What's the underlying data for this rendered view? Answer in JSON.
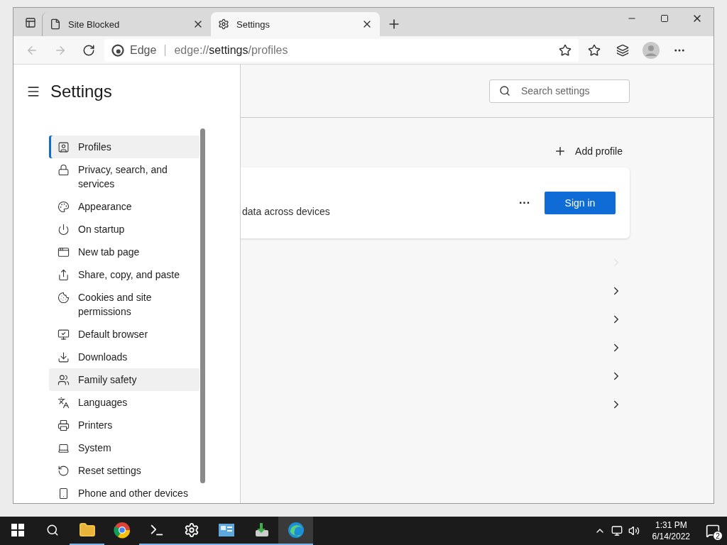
{
  "tabs": [
    {
      "label": "Site Blocked",
      "selected": false
    },
    {
      "label": "Settings",
      "selected": true
    }
  ],
  "address_bar": {
    "site_label": "Edge",
    "url_prefix": "edge://",
    "url_path": "settings",
    "url_suffix": "/profiles"
  },
  "sidebar": {
    "title": "Settings",
    "items": [
      {
        "label": "Profiles",
        "selected": true,
        "hovered": false
      },
      {
        "label": "Privacy, search, and services",
        "selected": false,
        "hovered": false
      },
      {
        "label": "Appearance",
        "selected": false,
        "hovered": false
      },
      {
        "label": "On startup",
        "selected": false,
        "hovered": false
      },
      {
        "label": "New tab page",
        "selected": false,
        "hovered": false
      },
      {
        "label": "Share, copy, and paste",
        "selected": false,
        "hovered": false
      },
      {
        "label": "Cookies and site permissions",
        "selected": false,
        "hovered": false
      },
      {
        "label": "Default browser",
        "selected": false,
        "hovered": false
      },
      {
        "label": "Downloads",
        "selected": false,
        "hovered": false
      },
      {
        "label": "Family safety",
        "selected": false,
        "hovered": true
      },
      {
        "label": "Languages",
        "selected": false,
        "hovered": false
      },
      {
        "label": "Printers",
        "selected": false,
        "hovered": false
      },
      {
        "label": "System",
        "selected": false,
        "hovered": false
      },
      {
        "label": "Reset settings",
        "selected": false,
        "hovered": false
      },
      {
        "label": "Phone and other devices",
        "selected": false,
        "hovered": false
      }
    ]
  },
  "search": {
    "placeholder": "Search settings"
  },
  "add_profile": "Add profile",
  "profile_card": {
    "description": "data across devices",
    "more": "···",
    "button": "Sign in"
  },
  "profile_rows": [
    {
      "disabled": true
    },
    {
      "disabled": false
    },
    {
      "disabled": false
    },
    {
      "disabled": false
    },
    {
      "disabled": false
    },
    {
      "disabled": false
    }
  ],
  "taskbar": {
    "apps": [
      {
        "running": true,
        "selected": false
      },
      {
        "running": false,
        "selected": false
      },
      {
        "running": true,
        "selected": false
      },
      {
        "running": true,
        "selected": false
      },
      {
        "running": true,
        "selected": false
      },
      {
        "running": true,
        "selected": false
      },
      {
        "running": true,
        "selected": true
      }
    ],
    "time": "1:31 PM",
    "date": "6/14/2022",
    "notifications": "2"
  }
}
